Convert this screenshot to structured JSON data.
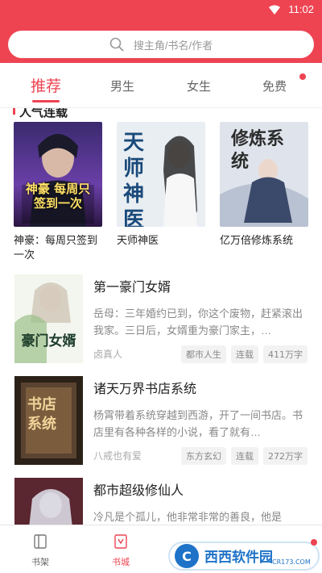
{
  "status_bar": {
    "time": "11:02"
  },
  "search": {
    "placeholder": "搜主角/书名/作者"
  },
  "tabs": [
    {
      "label": "推荐"
    },
    {
      "label": "男生"
    },
    {
      "label": "女生"
    },
    {
      "label": "免费"
    }
  ],
  "section": {
    "title": "人气连载"
  },
  "grid_books": [
    {
      "name": "神豪：每周只签到一次",
      "cover_text": "神豪 每周只 签到一次"
    },
    {
      "name": "天师神医",
      "cover_text": "天师神医"
    },
    {
      "name": "亿万倍修炼系统",
      "cover_text": "修炼系统"
    }
  ],
  "list_books": [
    {
      "title": "第一豪门女婿",
      "desc": "岳母：三年婚约已到，你这个废物，赶紧滚出我家。三日后，女婿重为豪门家主，…",
      "author": "卤真人",
      "tags": [
        "都市人生",
        "连载",
        "411万字"
      ],
      "cover_text": "豪门女婿"
    },
    {
      "title": "诸天万界书店系统",
      "desc": "杨霄带着系统穿越到西游，开了一间书店。书店里有各种各样的小说，看了就有…",
      "author": "八戒也有爱",
      "tags": [
        "东方玄幻",
        "连载",
        "272万字"
      ],
      "cover_text": "书店 系统"
    },
    {
      "title": "都市超级修仙人",
      "desc": "冷凡是个孤儿，他非常非常的善良，他是",
      "author": "",
      "tags": [],
      "cover_text": ""
    }
  ],
  "bottom_nav": [
    {
      "label": "书架"
    },
    {
      "label": "书城"
    }
  ],
  "watermark": {
    "text": "西西软件园",
    "sub": "CR173.COM"
  },
  "colors": {
    "accent": "#ee4452"
  }
}
